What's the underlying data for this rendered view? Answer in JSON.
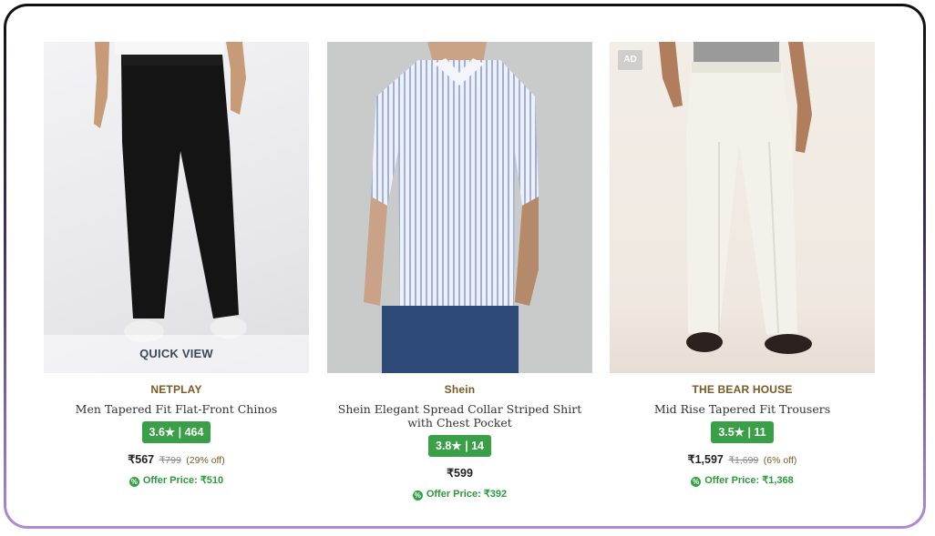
{
  "products": [
    {
      "brand": "NETPLAY",
      "name": "Men Tapered Fit Flat-Front Chinos",
      "rating": "3.6",
      "reviews": "464",
      "price": "₹567",
      "mrp": "₹799",
      "discount": "(29% off)",
      "offer_label": "Offer Price:",
      "offer_price": "₹510",
      "overlay": "QUICK VIEW"
    },
    {
      "brand": "Shein",
      "name": "Shein Elegant Spread Collar Striped Shirt with Chest Pocket",
      "rating": "3.8",
      "reviews": "14",
      "price": "₹599",
      "offer_label": "Offer Price:",
      "offer_price": "₹392"
    },
    {
      "brand": "THE BEAR HOUSE",
      "name": "Mid Rise Tapered Fit Trousers",
      "rating": "3.5",
      "reviews": "11",
      "price": "₹1,597",
      "mrp": "₹1,699",
      "discount": "(6% off)",
      "offer_label": "Offer Price:",
      "offer_price": "₹1,368",
      "badge": "AD"
    }
  ],
  "glyphs": {
    "star": "★",
    "sep": "|",
    "offer_icon": "%"
  },
  "colors": {
    "rating_bg": "#3aa047",
    "brand_text": "#7a5a25",
    "offer_text": "#2a9a3a"
  }
}
